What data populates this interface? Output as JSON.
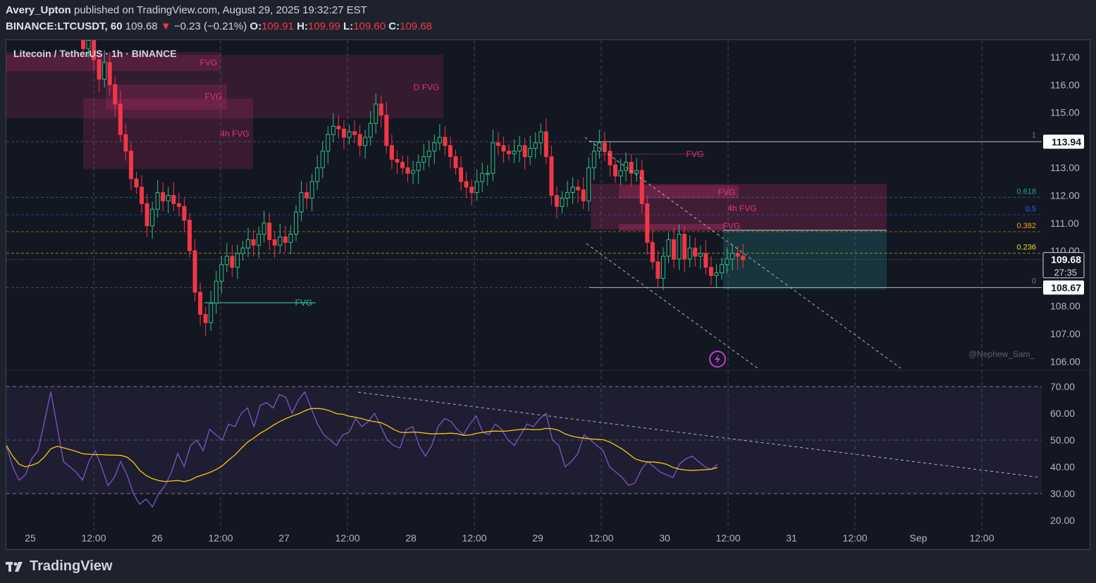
{
  "header": {
    "author": "Avery_Upton",
    "published": "published on TradingView.com, August 29, 2025 19:32:27 EST",
    "symbol": "BINANCE:LTCUSDT, 60",
    "last": "109.68",
    "change": "−0.23 (−0.21%)",
    "o_label": "O:",
    "o": "109.91",
    "h_label": "H:",
    "h": "109.99",
    "l_label": "L:",
    "l": "109.60",
    "c_label": "C:",
    "c": "109.68"
  },
  "legend": "Litecoin / TetherUS · 1h · BINANCE",
  "watermark": "@Nephew_Sam_",
  "brand": "TradingView",
  "price_axis": {
    "ticks": [
      "117.00",
      "116.00",
      "115.00",
      "113.00",
      "112.00",
      "111.00",
      "110.00",
      "108.00",
      "107.00",
      "106.00"
    ],
    "labels": {
      "high": "113.94",
      "last": "109.68",
      "countdown": "27:35",
      "low": "108.67"
    }
  },
  "rsi_axis": {
    "ticks": [
      "70.00",
      "60.00",
      "50.00",
      "40.00",
      "30.00",
      "20.00"
    ]
  },
  "time_axis": [
    "25",
    "12:00",
    "26",
    "12:00",
    "27",
    "12:00",
    "28",
    "12:00",
    "29",
    "12:00",
    "30",
    "12:00",
    "31",
    "12:00",
    "Sep",
    "12:00"
  ],
  "annotations": {
    "fvg": "FVG",
    "d_fvg": "D FVG",
    "h4_fvg": "4h FVG",
    "fib": [
      "1",
      "0.618",
      "0.5",
      "0.382",
      "0.236",
      "0"
    ]
  },
  "colors": {
    "up": "#2cbf8a",
    "down": "#f23645",
    "fvg": "#e2347c",
    "rsi": "#7e57c2",
    "rsi_ma": "#f6c90e",
    "accent": "#c13ad6"
  },
  "chart_data": {
    "type": "candlestick",
    "symbol": "LTCUSDT",
    "interval": "1h",
    "ylim": [
      105.8,
      117.8
    ],
    "last_price": 109.68,
    "swing_high": 113.94,
    "swing_low": 108.67,
    "fib_levels": [
      {
        "level": "1",
        "price": 113.94
      },
      {
        "level": "0.618",
        "price": 111.93
      },
      {
        "level": "0.5",
        "price": 111.3
      },
      {
        "level": "0.382",
        "price": 110.69
      },
      {
        "level": "0.236",
        "price": 109.91
      },
      {
        "level": "0",
        "price": 108.67
      }
    ],
    "closes": [
      117.3,
      117.6,
      116.9,
      116.2,
      116.8,
      116.0,
      115.3,
      114.2,
      113.6,
      112.6,
      112.3,
      111.7,
      110.9,
      111.5,
      112.1,
      111.8,
      112.0,
      111.7,
      111.6,
      111.1,
      110.0,
      108.5,
      107.7,
      107.4,
      108.1,
      108.9,
      109.5,
      109.8,
      109.4,
      109.9,
      110.1,
      110.4,
      110.2,
      110.6,
      111.0,
      110.4,
      110.2,
      110.5,
      110.3,
      110.6,
      111.4,
      112.1,
      111.9,
      112.5,
      113.0,
      113.6,
      114.2,
      114.5,
      114.4,
      114.1,
      114.3,
      114.2,
      113.8,
      114.1,
      114.6,
      115.3,
      114.9,
      113.8,
      113.3,
      113.2,
      113.0,
      112.8,
      112.9,
      113.2,
      113.4,
      113.6,
      113.9,
      114.1,
      113.8,
      113.4,
      113.0,
      112.5,
      112.3,
      112.1,
      112.5,
      112.8,
      112.8,
      113.9,
      113.8,
      113.6,
      113.5,
      113.6,
      113.8,
      113.4,
      113.7,
      113.9,
      114.3,
      113.4,
      112.0,
      111.6,
      111.9,
      112.1,
      112.3,
      112.2,
      111.8,
      113.0,
      113.6,
      113.9,
      113.6,
      113.1,
      112.7,
      112.9,
      113.2,
      112.8,
      112.9,
      111.7,
      110.3,
      109.6,
      109.0,
      109.8,
      110.4,
      109.7,
      110.6,
      109.7,
      110.1,
      109.8,
      109.9,
      109.4,
      109.1,
      109.2,
      109.5,
      109.7,
      109.9,
      109.8,
      109.68
    ],
    "rsi": [
      48,
      40,
      35,
      37,
      43,
      46,
      57,
      68,
      55,
      42,
      40,
      38,
      35,
      42,
      46,
      40,
      33,
      36,
      42,
      37,
      30,
      26,
      28,
      25,
      30,
      33,
      38,
      45,
      40,
      48,
      50,
      46,
      54,
      52,
      50,
      56,
      55,
      60,
      62,
      55,
      63,
      64,
      62,
      67,
      66,
      60,
      65,
      68,
      62,
      56,
      52,
      50,
      48,
      52,
      53,
      58,
      55,
      57,
      60,
      55,
      50,
      48,
      47,
      54,
      55,
      48,
      44,
      48,
      55,
      58,
      57,
      54,
      52,
      56,
      59,
      53,
      52,
      56,
      54,
      50,
      48,
      52,
      56,
      55,
      58,
      60,
      50,
      48,
      40,
      42,
      45,
      52,
      50,
      48,
      46,
      40,
      38,
      36,
      33,
      34,
      39,
      42,
      40,
      38,
      37,
      36,
      41,
      43,
      44,
      42,
      40,
      39,
      41
    ],
    "rsi_ma_ref": {
      "overbought": 70,
      "mid": 50,
      "oversold": 30
    }
  }
}
